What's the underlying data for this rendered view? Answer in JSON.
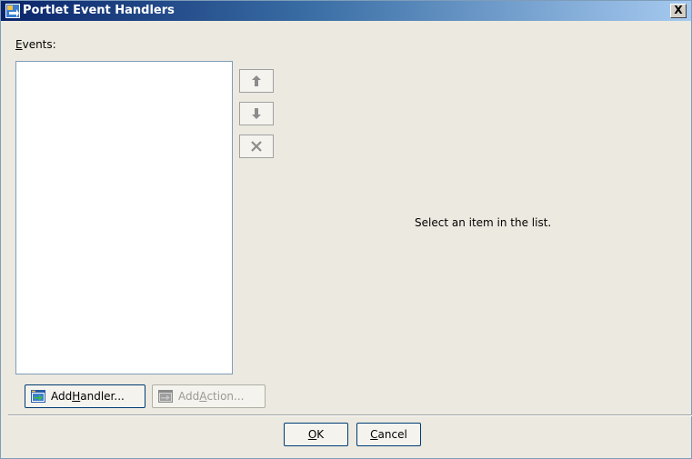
{
  "window": {
    "title": "Portlet Event Handlers",
    "close_label": "X"
  },
  "events": {
    "label_mnemonic": "E",
    "label_rest": "vents:",
    "items": []
  },
  "side_buttons": {
    "move_up_icon": "arrow-up-icon",
    "move_down_icon": "arrow-down-icon",
    "remove_icon": "x-icon"
  },
  "detail": {
    "placeholder": "Select an item in the list."
  },
  "actions": {
    "add_handler": {
      "pre": "Add ",
      "mnemonic": "H",
      "post": "andler...",
      "enabled": true
    },
    "add_action": {
      "pre": "Add ",
      "mnemonic": "A",
      "post": "ction...",
      "enabled": false
    }
  },
  "footer": {
    "ok": {
      "mnemonic": "O",
      "post": "K"
    },
    "cancel": {
      "mnemonic": "C",
      "post": "ancel"
    }
  }
}
